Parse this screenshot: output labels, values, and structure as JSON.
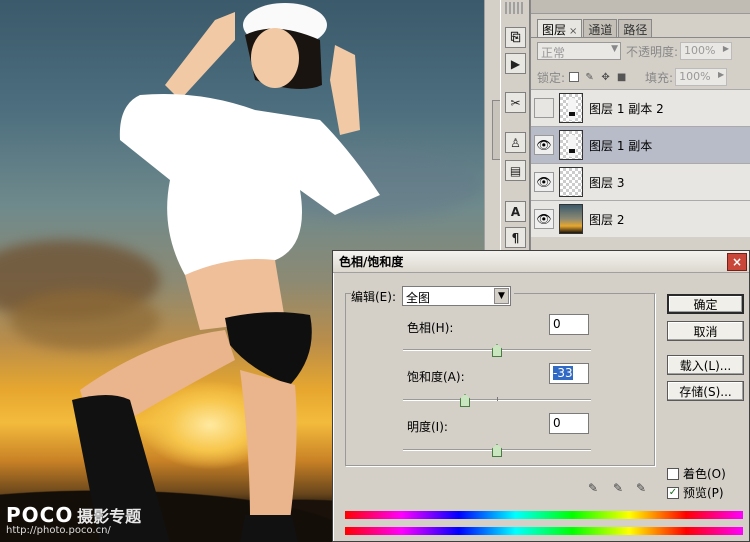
{
  "watermark": {
    "brand": "POCO",
    "brand_cn": "摄影专题",
    "url": "http://photo.poco.cn/"
  },
  "layers_panel": {
    "tabs": [
      {
        "label": "图层",
        "close": "×"
      },
      {
        "label": "通道"
      },
      {
        "label": "路径"
      }
    ],
    "blend_mode": "正常",
    "opacity_label": "不透明度:",
    "opacity_value": "100%",
    "lock_label": "锁定:",
    "fill_label": "填充:",
    "fill_value": "100%",
    "layers": [
      {
        "name": "图层 1 副本 2",
        "visible": false,
        "selected": false
      },
      {
        "name": "图层 1 副本",
        "visible": true,
        "selected": true
      },
      {
        "name": "图层 3",
        "visible": true,
        "selected": false
      },
      {
        "name": "图层 2",
        "visible": true,
        "selected": false
      }
    ]
  },
  "tools": [
    {
      "icon": "history-brush-icon",
      "glyph": "⎘"
    },
    {
      "icon": "actions-play-icon",
      "glyph": "▶"
    },
    {
      "icon": "tools-icon",
      "glyph": "✂"
    },
    {
      "icon": "clone-source-icon",
      "glyph": "♙"
    },
    {
      "icon": "layer-comps-icon",
      "glyph": "▤"
    },
    {
      "icon": "character-icon",
      "glyph": "A"
    },
    {
      "icon": "paragraph-icon",
      "glyph": "¶"
    }
  ],
  "dialog": {
    "title": "色相/饱和度",
    "close": "×",
    "edit_label": "编辑(E):",
    "edit_value": "全图",
    "hue": {
      "label": "色相(H):",
      "value": "0"
    },
    "saturation": {
      "label": "饱和度(A):",
      "value": "-33"
    },
    "lightness": {
      "label": "明度(I):",
      "value": "0"
    },
    "buttons": {
      "ok": "确定",
      "cancel": "取消",
      "load": "载入(L)...",
      "save": "存储(S)..."
    },
    "colorize_label": "着色(O)",
    "colorize_checked": false,
    "preview_label": "预览(P)",
    "preview_checked": true,
    "preview_mark": "✓"
  }
}
